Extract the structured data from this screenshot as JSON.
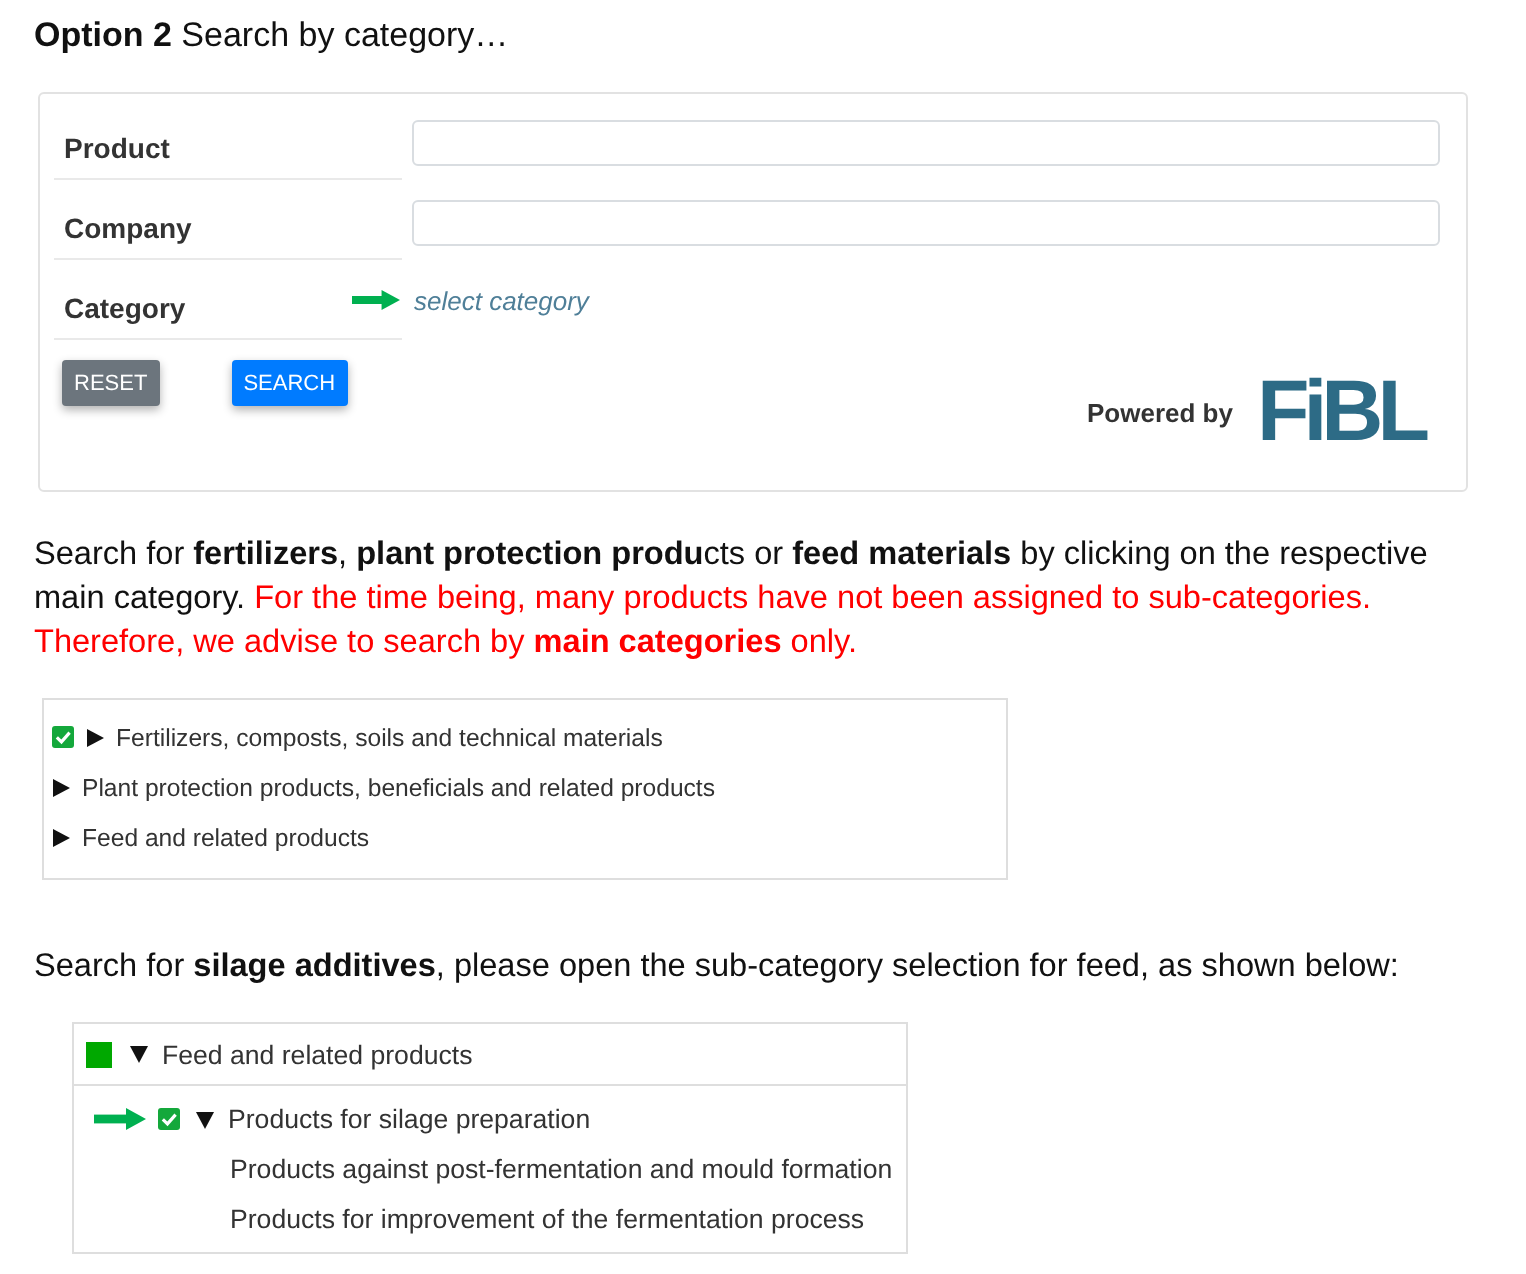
{
  "heading": "**Option 2** Search by category…",
  "search_form": {
    "fields": [
      {
        "label": "Product",
        "kind": "input",
        "annotated": false
      },
      {
        "label": "Company",
        "kind": "input",
        "annotated": false
      },
      {
        "label": "Category",
        "kind": "link",
        "link_text": "select category",
        "annotated": true
      }
    ],
    "buttons": [
      {
        "label": "RESET",
        "kind": "secondary"
      },
      {
        "label": "SEARCH",
        "kind": "primary"
      }
    ],
    "powered_by": {
      "label": "Powered by",
      "logo": "FiBL"
    }
  },
  "intro_text": [
    {
      "kind": "normal",
      "text": "Search for **fertilizers**, **plant protection produ**cts or **feed materials** by clicking on the respective main category."
    },
    {
      "kind": "warning",
      "text": "For the time being, many products have not been assigned to sub-categories.\nTherefore, we advise to search by **main categories** only."
    }
  ],
  "main_categories": [
    {
      "label": "Fertilizers, composts, soils and technical materials",
      "checked": true,
      "indeterminate": false,
      "expanded": false,
      "annotated": false
    },
    {
      "label": "Plant protection products, beneficials and related products",
      "checked": false,
      "indeterminate": false,
      "expanded": false,
      "annotated": false
    },
    {
      "label": "Feed and related products",
      "checked": false,
      "indeterminate": false,
      "expanded": false,
      "annotated": false
    }
  ],
  "silage_text": "Search for **silage additives**, please open the sub-category selection for feed, as shown below:",
  "feed_tree": [
    {
      "label": "Feed and related products",
      "checked": false,
      "indeterminate": true,
      "expanded": true,
      "annotated": false,
      "children": [
        {
          "label": "Products for silage preparation",
          "checked": true,
          "indeterminate": false,
          "expanded": true,
          "annotated": true,
          "children": [
            {
              "label": "Products against post-fermentation and mould formation",
              "checked": false,
              "indeterminate": false,
              "annotated": false
            },
            {
              "label": "Products for improvement of the fermentation process",
              "checked": false,
              "indeterminate": false,
              "annotated": false
            }
          ]
        }
      ]
    }
  ]
}
